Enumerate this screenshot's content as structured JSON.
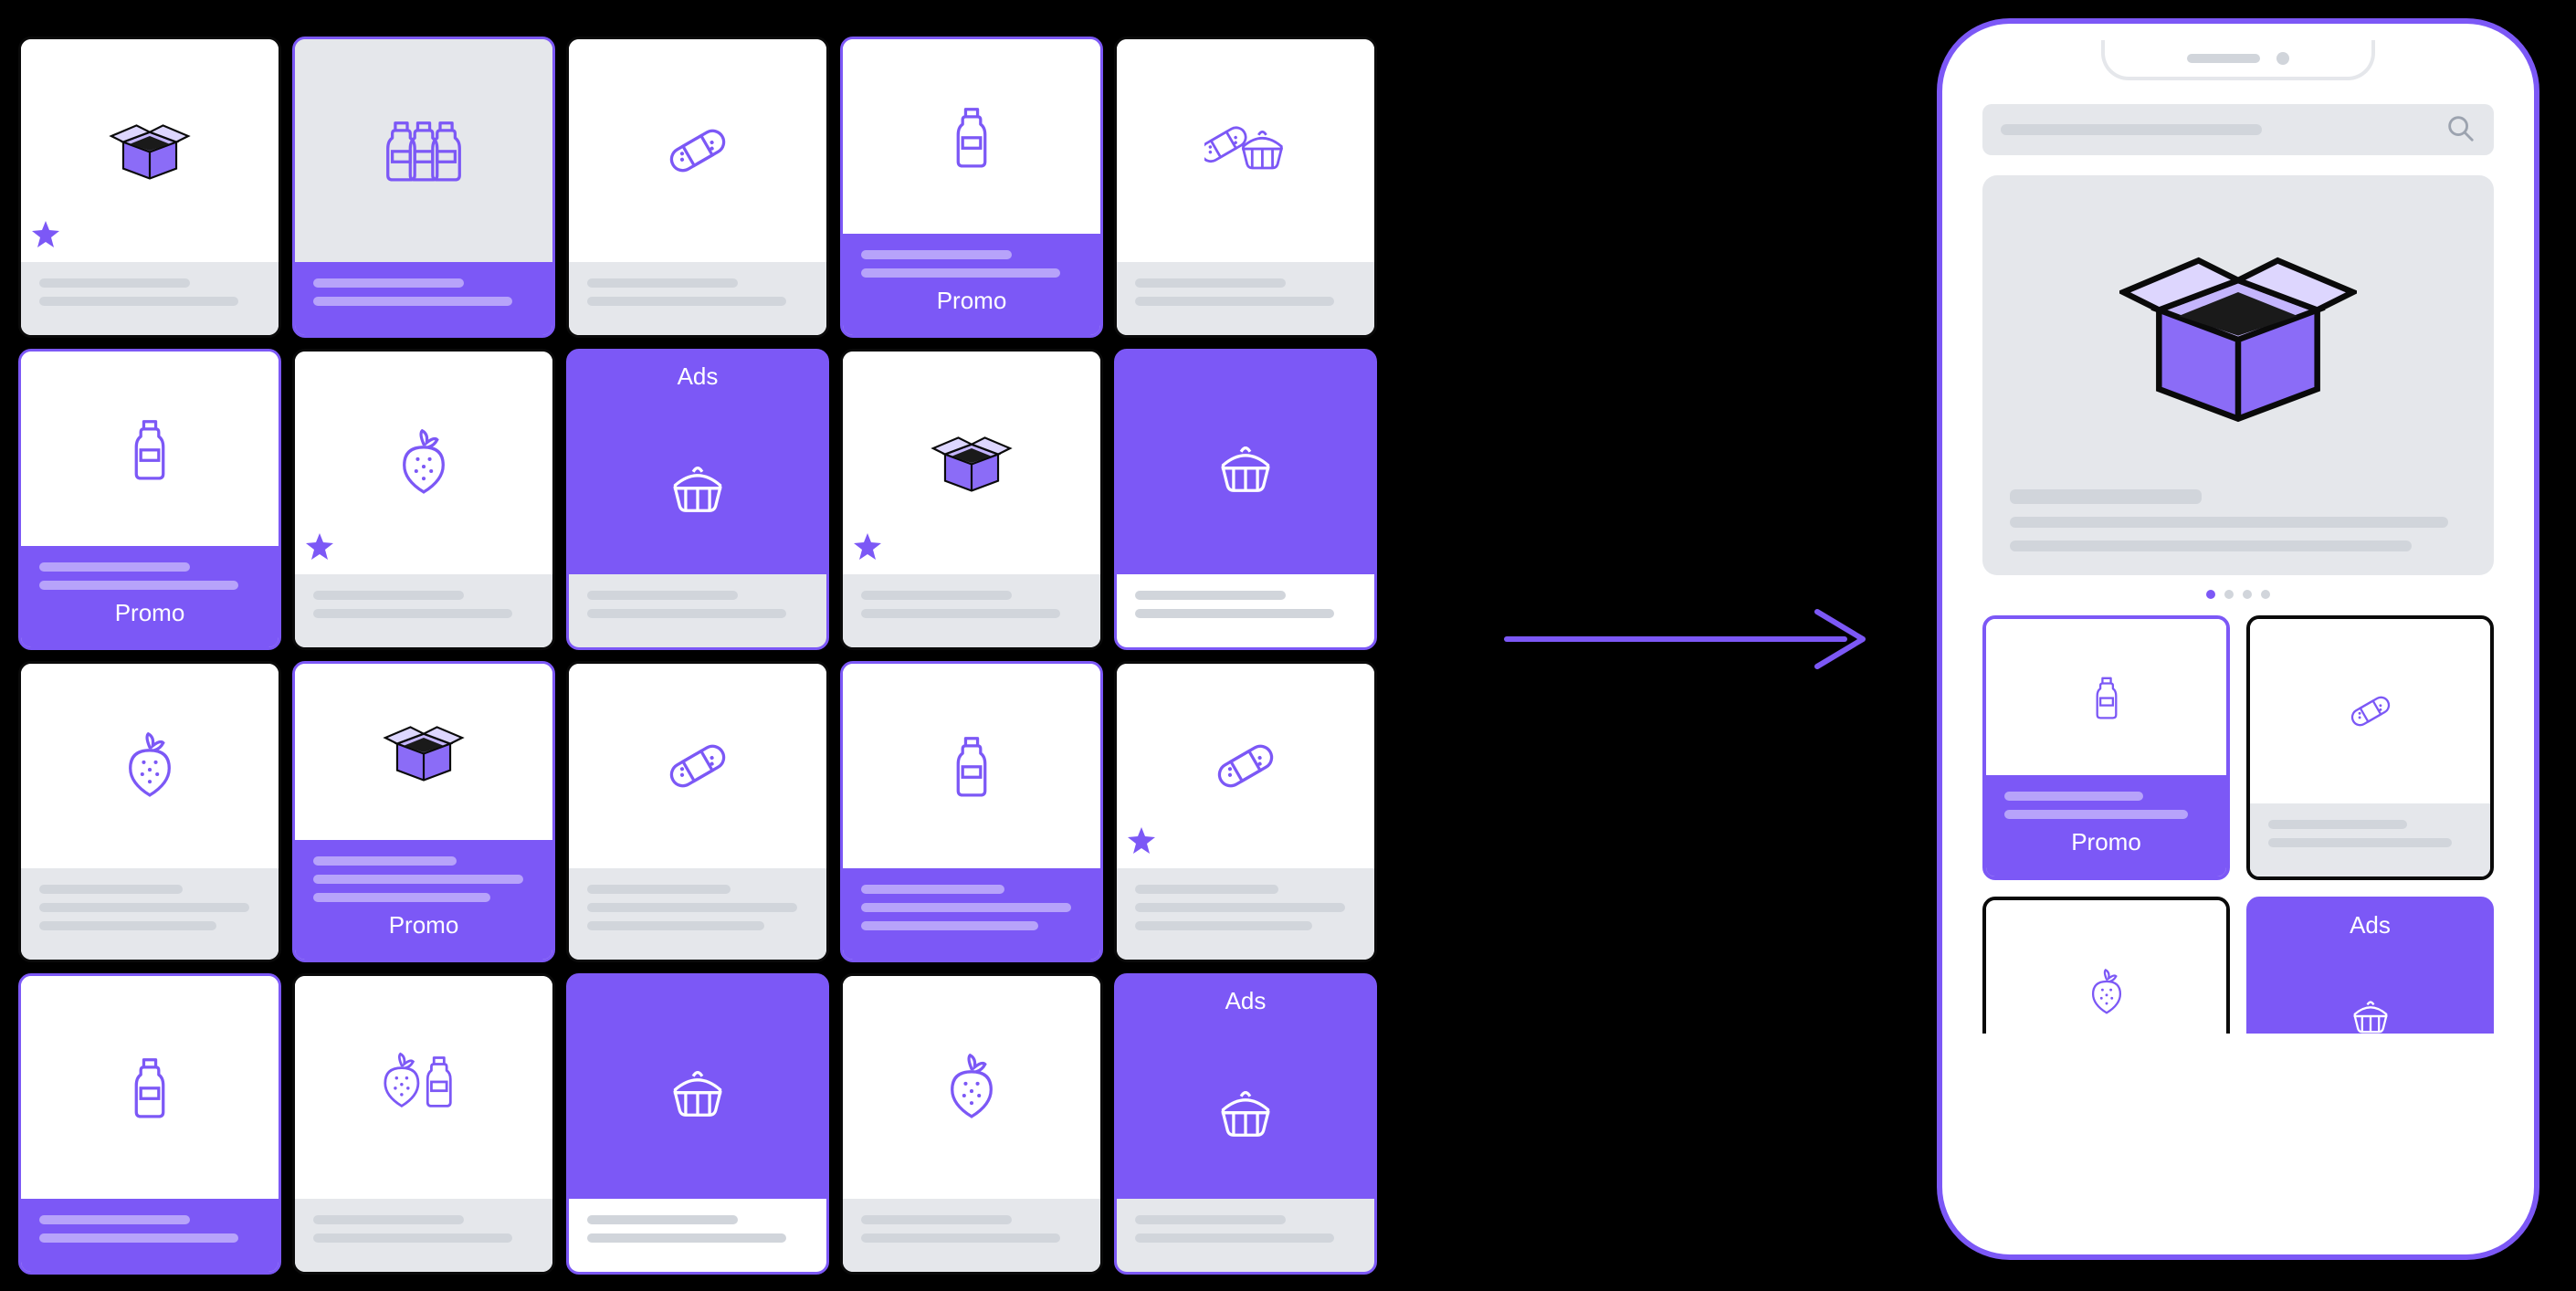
{
  "labels": {
    "promo": "Promo",
    "ads": "Ads"
  },
  "icons": {
    "box": "box-icon",
    "bottles": "bottles-icon",
    "bandaid": "bandaid-icon",
    "bottle": "bottle-icon",
    "bandaid_pie": "bandaid-pie-icon",
    "strawberry": "strawberry-icon",
    "pie": "pie-icon",
    "strawberry_bottle": "strawberry-bottle-icon"
  },
  "grid": [
    [
      {
        "variant": "default",
        "icon": "box",
        "star": true
      },
      {
        "variant": "selected",
        "icon": "bottles"
      },
      {
        "variant": "default",
        "icon": "bandaid"
      },
      {
        "variant": "promo",
        "icon": "bottle",
        "label": "promo"
      },
      {
        "variant": "default",
        "icon": "bandaid_pie"
      }
    ],
    [
      {
        "variant": "promo",
        "icon": "bottle",
        "label": "promo"
      },
      {
        "variant": "default",
        "icon": "strawberry",
        "star": true
      },
      {
        "variant": "ads",
        "icon": "pie",
        "label": "ads"
      },
      {
        "variant": "default",
        "icon": "box",
        "star": true
      },
      {
        "variant": "solid",
        "icon": "pie"
      }
    ],
    [
      {
        "variant": "default",
        "icon": "strawberry",
        "three": true
      },
      {
        "variant": "promo",
        "icon": "box",
        "label": "promo",
        "three": true
      },
      {
        "variant": "default",
        "icon": "bandaid",
        "three": true
      },
      {
        "variant": "promo",
        "icon": "bottle",
        "three": true
      },
      {
        "variant": "default",
        "icon": "bandaid",
        "star": true,
        "three": true
      }
    ],
    [
      {
        "variant": "promo",
        "icon": "bottle"
      },
      {
        "variant": "default",
        "icon": "strawberry_bottle"
      },
      {
        "variant": "solid",
        "icon": "pie"
      },
      {
        "variant": "default",
        "icon": "strawberry"
      },
      {
        "variant": "ads",
        "icon": "pie",
        "label": "ads"
      }
    ]
  ],
  "phone": {
    "hero_icon": "box",
    "page_dots": 4,
    "active_dot": 0,
    "cards": [
      {
        "variant": "promo",
        "icon": "bottle",
        "label": "promo"
      },
      {
        "variant": "default",
        "icon": "bandaid"
      },
      {
        "variant": "default",
        "icon": "strawberry",
        "star": true
      },
      {
        "variant": "ads",
        "icon": "pie",
        "label": "ads"
      }
    ]
  }
}
